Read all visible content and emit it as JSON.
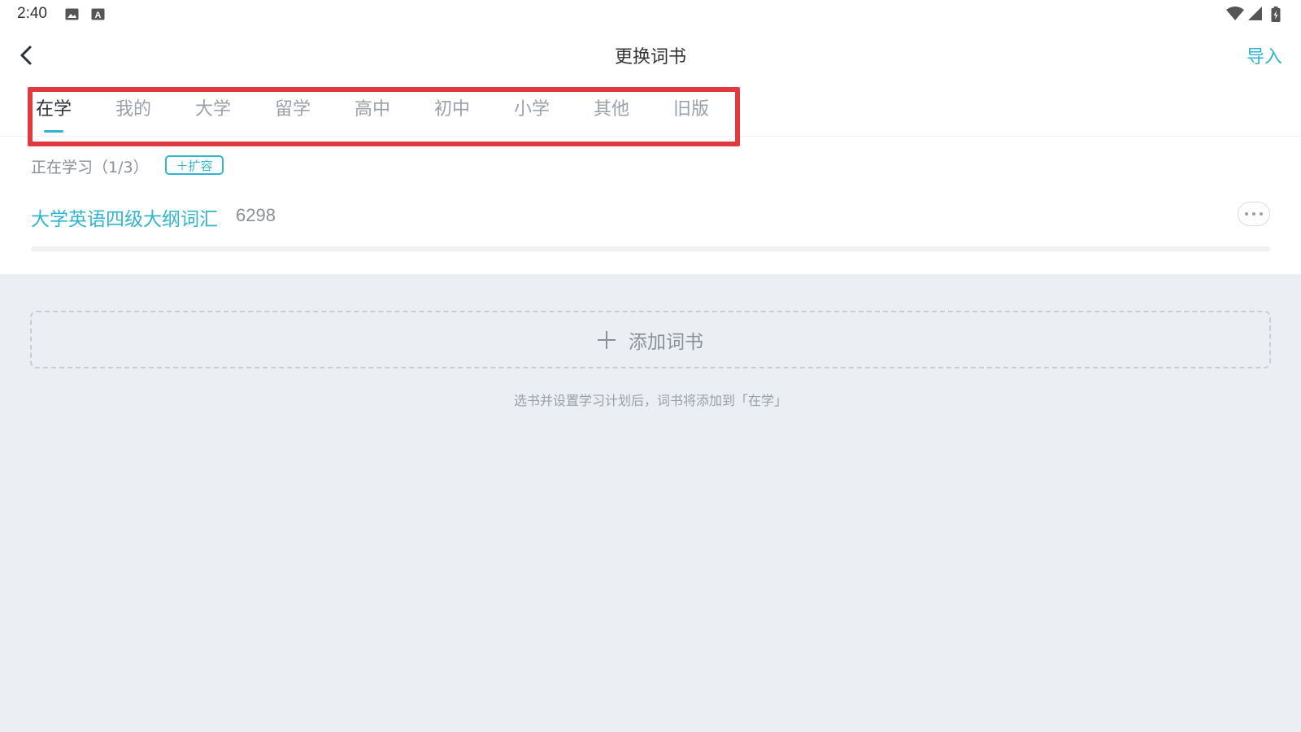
{
  "status_bar": {
    "time": "2:40",
    "left_icons": [
      "image-icon",
      "text-a-icon"
    ],
    "right_icons": [
      "wifi-icon",
      "signal-icon",
      "battery-icon"
    ]
  },
  "header": {
    "title": "更换词书",
    "import_label": "导入"
  },
  "tabs": [
    {
      "label": "在学",
      "active": true
    },
    {
      "label": "我的",
      "active": false
    },
    {
      "label": "大学",
      "active": false
    },
    {
      "label": "留学",
      "active": false
    },
    {
      "label": "高中",
      "active": false
    },
    {
      "label": "初中",
      "active": false
    },
    {
      "label": "小学",
      "active": false
    },
    {
      "label": "其他",
      "active": false
    },
    {
      "label": "旧版",
      "active": false
    }
  ],
  "learning": {
    "section_label": "正在学习（1/3）",
    "expand_label": "＋扩容",
    "books": [
      {
        "title": "大学英语四级大纲词汇",
        "count": "6298",
        "progress": 0.0
      }
    ]
  },
  "add_book": {
    "label": "添加词书",
    "hint": "选书并设置学习计划后，词书将添加到「在学」"
  },
  "colors": {
    "accent": "#31b4cf",
    "highlight_box": "#e0393f",
    "background_lower": "#ebeff3"
  }
}
